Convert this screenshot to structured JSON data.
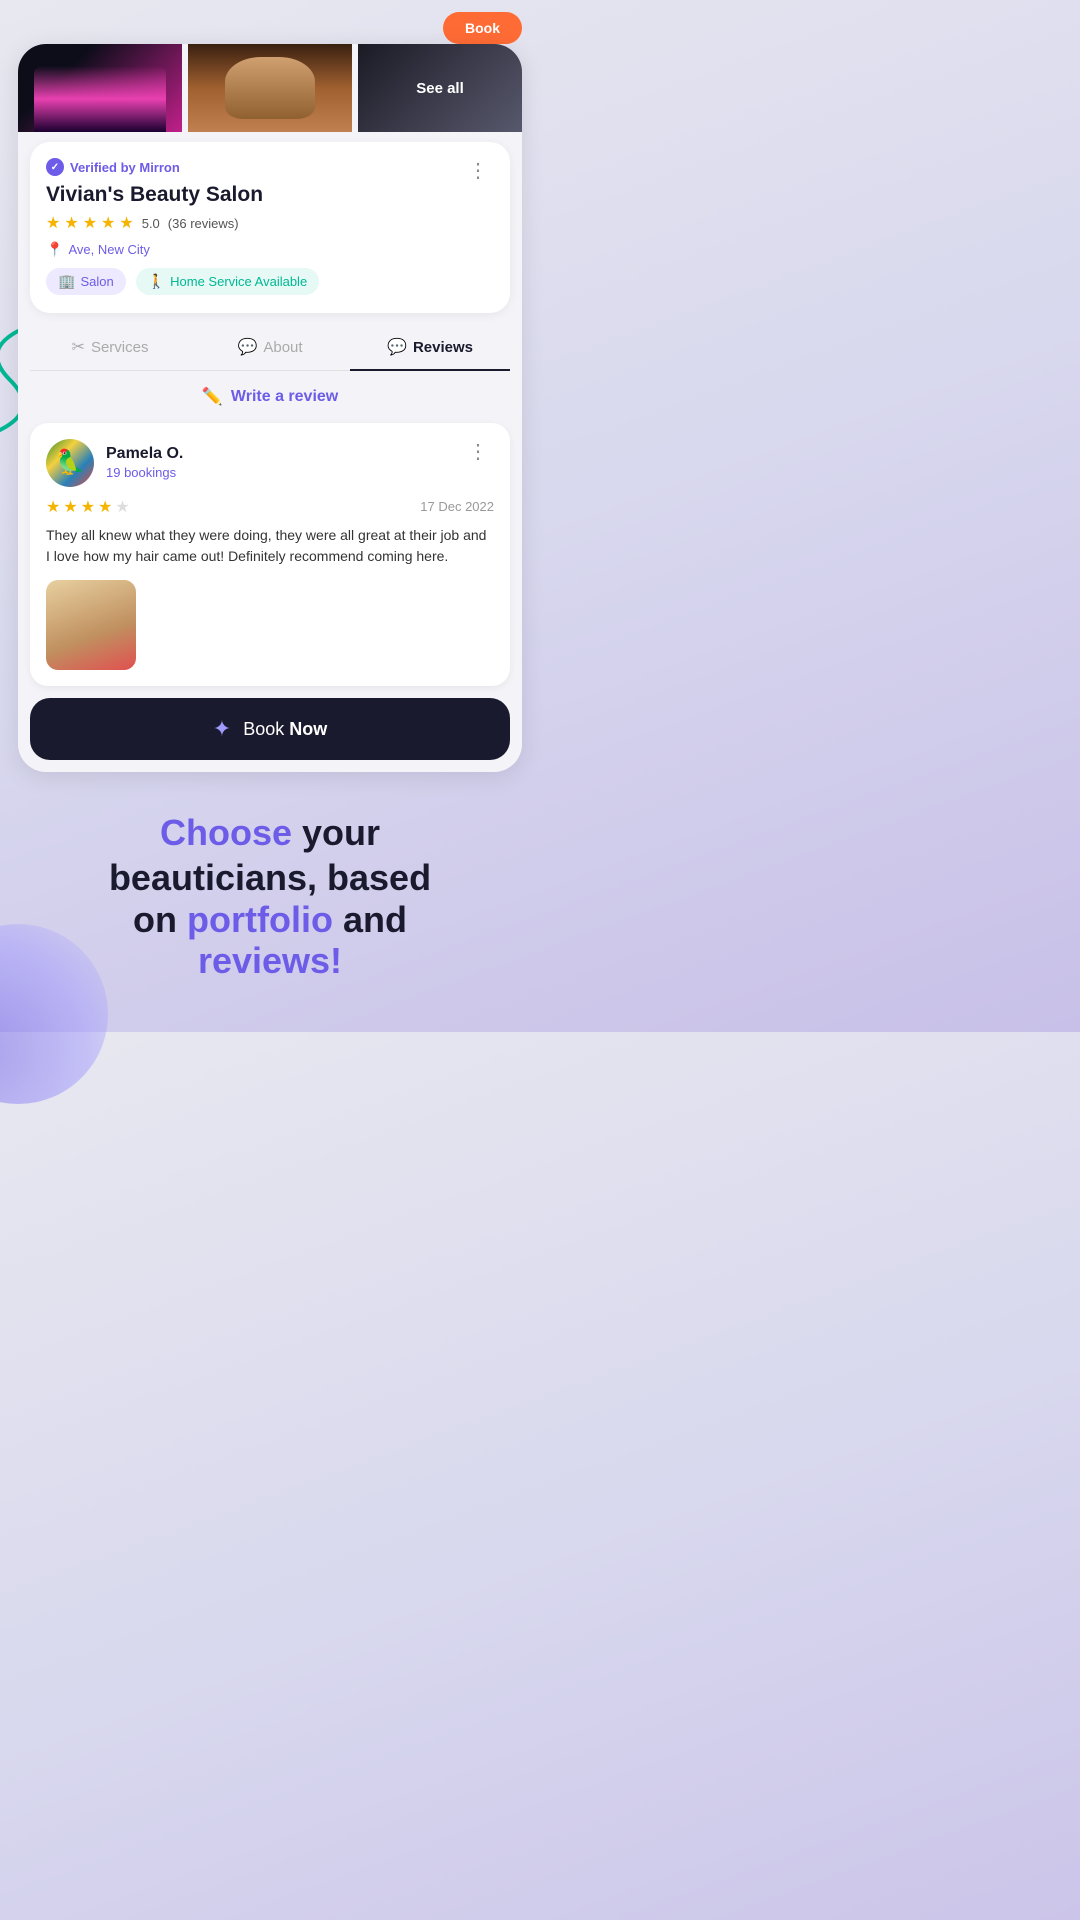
{
  "app": {
    "title": "Vivian's Beauty Salon"
  },
  "top_button": "Book",
  "photos": [
    {
      "label": "Photo 1"
    },
    {
      "label": "Photo 2"
    },
    {
      "label": "See all"
    }
  ],
  "salon": {
    "verified_label": "Verified by Mirron",
    "name": "Vivian's Beauty Salon",
    "rating_value": "5.0",
    "rating_count": "(36 reviews)",
    "location": "Ave, New City",
    "tags": [
      {
        "id": "salon",
        "icon": "🏢",
        "label": "Salon"
      },
      {
        "id": "home",
        "icon": "🚶",
        "label": "Home Service Available"
      }
    ]
  },
  "tabs": [
    {
      "id": "services",
      "icon": "✂",
      "label": "Services",
      "active": false
    },
    {
      "id": "about",
      "icon": "💬",
      "label": "About",
      "active": false
    },
    {
      "id": "reviews",
      "icon": "💬",
      "label": "Reviews",
      "active": true
    }
  ],
  "write_review": {
    "label": "Write a review"
  },
  "review": {
    "reviewer_name": "Pamela O.",
    "bookings": "19 bookings",
    "rating": 4,
    "max_rating": 5,
    "date": "17 Dec 2022",
    "text": "They all knew what they were doing, they were all great at their job and I love how my hair came out! Definitely recommend coming here.",
    "has_photo": true
  },
  "book_button": {
    "prefix": "Book ",
    "suffix": "Now"
  },
  "tagline": {
    "line1_plain": " your",
    "line1_highlight": "Choose",
    "line2": "beauticians, based",
    "line3_plain": "on ",
    "line3_highlight": "portfolio",
    "line3_end": " and",
    "line4_highlight": "reviews!"
  }
}
